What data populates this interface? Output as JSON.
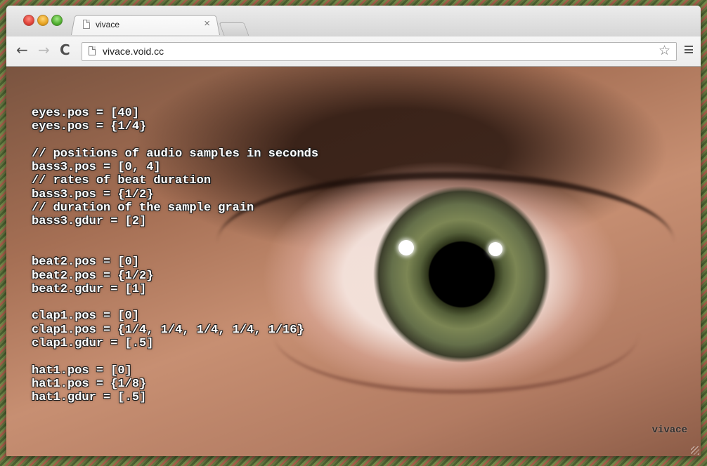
{
  "tab": {
    "title": "vivace",
    "close": "×"
  },
  "toolbar": {
    "back": "←",
    "forward": "→",
    "reload": "C",
    "url": "vivace.void.cc",
    "bookmark": "☆",
    "menu_icon": "menu-icon"
  },
  "code_lines": [
    "eyes.pos = [40]",
    "eyes.pos = {1/4}",
    "",
    "// positions of audio samples in seconds",
    "bass3.pos = [0, 4]",
    "// rates of beat duration",
    "bass3.pos = {1/2}",
    "// duration of the sample grain",
    "bass3.gdur = [2]",
    "",
    "",
    "beat2.pos = [0]",
    "beat2.pos = {1/2}",
    "beat2.gdur = [1]",
    "",
    "clap1.pos = [0]",
    "clap1.pos = {1/4, 1/4, 1/4, 1/4, 1/16}",
    "clap1.gdur = [.5]",
    "",
    "hat1.pos = [0]",
    "hat1.pos = {1/8}",
    "hat1.gdur = [.5]"
  ],
  "brand": "vivace",
  "colors": {
    "code_text": "#ffffff",
    "titlebar": "#dadada",
    "close": "#e0443a",
    "minimize": "#e7a323",
    "maximize": "#52b032"
  }
}
